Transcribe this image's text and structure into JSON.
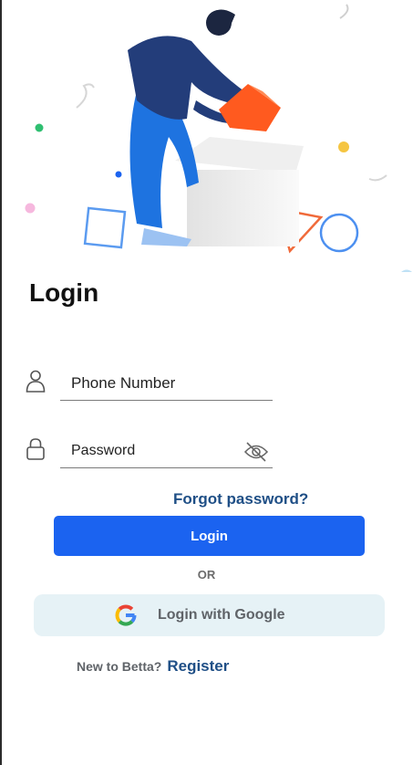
{
  "login": {
    "title": "Login",
    "phone": {
      "placeholder": "Phone Number"
    },
    "password": {
      "placeholder": "Password"
    },
    "forgot_label": "Forgot password?",
    "submit_label": "Login",
    "divider_text": "OR",
    "google_label": "Login with Google",
    "signup": {
      "question": "New to Betta?",
      "link": "Register"
    }
  },
  "colors": {
    "primary": "#1b63f0",
    "link": "#1f4f86",
    "google_bg": "#e6f2f6",
    "text": "#111111"
  },
  "icons": [
    "user-icon",
    "lock-icon",
    "eye-off-icon",
    "google-logo-icon"
  ]
}
